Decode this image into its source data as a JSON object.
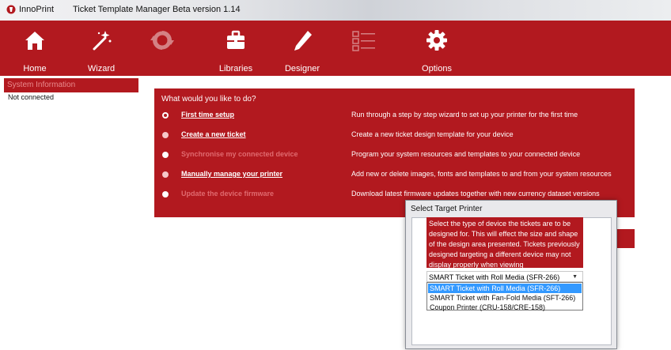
{
  "titlebar": {
    "app_name": "InnoPrint",
    "window_title": "Ticket Template Manager Beta version 1.14"
  },
  "ribbon": {
    "items": [
      {
        "label": "Home",
        "icon": "home-icon",
        "enabled": true
      },
      {
        "label": "Wizard",
        "icon": "wand-icon",
        "enabled": true
      },
      {
        "label": "",
        "icon": "sync-icon",
        "enabled": false
      },
      {
        "label": "Libraries",
        "icon": "briefcase-icon",
        "enabled": true
      },
      {
        "label": "Designer",
        "icon": "pen-icon",
        "enabled": true
      },
      {
        "label": "",
        "icon": "list-icon",
        "enabled": false
      },
      {
        "label": "Options",
        "icon": "gear-icon",
        "enabled": true
      }
    ]
  },
  "sidebar": {
    "heading": "System Information",
    "status": "Not connected"
  },
  "tasks": {
    "question": "What would you like to do?",
    "options": [
      {
        "name": "First time setup",
        "desc": "Run through a step by step wizard to set up your printer for the first time",
        "selected": true,
        "enabled": true
      },
      {
        "name": "Create a new ticket",
        "desc": "Create a new ticket design template for your device",
        "selected": false,
        "enabled": true
      },
      {
        "name": "Synchronise my connected device",
        "desc": "Program your system resources and templates to your connected device",
        "selected": false,
        "enabled": false
      },
      {
        "name": "Manually manage your printer",
        "desc": "Add new or delete images, fonts and templates to and from your system resources",
        "selected": false,
        "enabled": true
      },
      {
        "name": "Update the device firmware",
        "desc": "Download latest firmware updates together with new currency dataset versions",
        "selected": false,
        "enabled": false
      }
    ]
  },
  "dialog": {
    "title": "Select Target Printer",
    "message": "Select the type of device the tickets are to be designed for. This will effect the size and shape of the design area presented. Tickets previously designed targeting a different device may not display properly when viewing",
    "selected_value": "SMART Ticket with Roll Media (SFR-266)",
    "options": [
      "SMART Ticket with Roll Media (SFR-266)",
      "SMART Ticket with Fan-Fold Media (SFT-266)",
      "Coupon Printer (CRU-158/CRE-158)"
    ],
    "highlighted_index": 0
  },
  "colors": {
    "accent": "#b2191f",
    "highlight": "#3399ff"
  }
}
